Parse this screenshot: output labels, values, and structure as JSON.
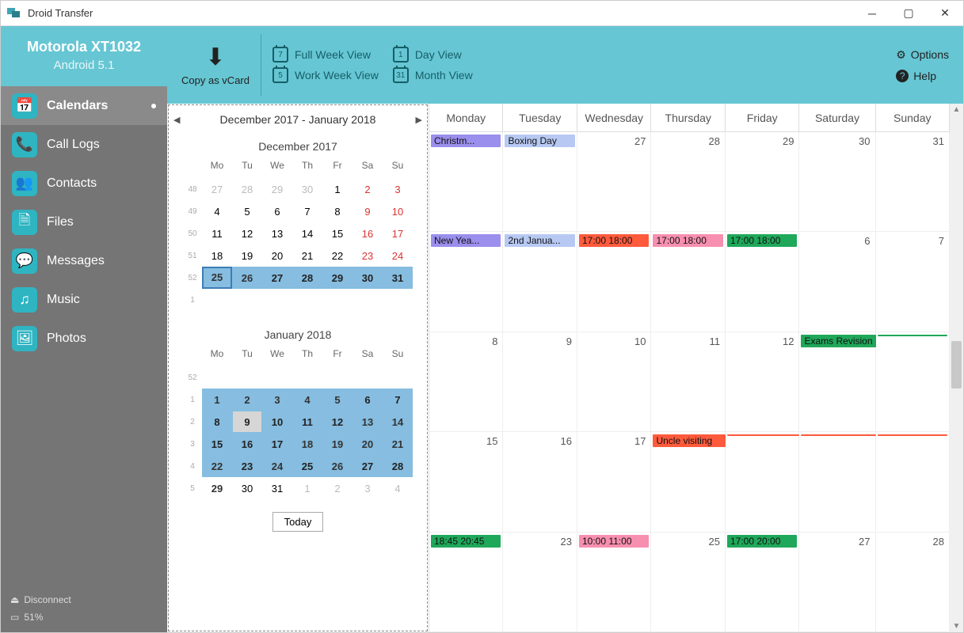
{
  "window": {
    "title": "Droid Transfer"
  },
  "device": {
    "name": "Motorola XT1032",
    "os": "Android 5.1"
  },
  "sidebar": {
    "items": [
      {
        "label": "Calendars",
        "icon": "calendar"
      },
      {
        "label": "Call Logs",
        "icon": "phone"
      },
      {
        "label": "Contacts",
        "icon": "contacts"
      },
      {
        "label": "Files",
        "icon": "files"
      },
      {
        "label": "Messages",
        "icon": "messages"
      },
      {
        "label": "Music",
        "icon": "music"
      },
      {
        "label": "Photos",
        "icon": "photos"
      }
    ],
    "active_index": 0,
    "disconnect": "Disconnect",
    "battery_pct": "51%"
  },
  "toolbar": {
    "copy_label": "Copy as vCard",
    "view_full": "Full Week View",
    "view_day": "Day View",
    "view_work": "Work Week View",
    "view_month": "Month View",
    "options": "Options",
    "help": "Help",
    "view_icon_full": "7",
    "view_icon_day": "1",
    "view_icon_work": "5",
    "view_icon_month": "31"
  },
  "mini_calendar": {
    "range_label": "December 2017 - January 2018",
    "today_label": "Today",
    "day_headers": [
      "Mo",
      "Tu",
      "We",
      "Th",
      "Fr",
      "Sa",
      "Su"
    ],
    "months": [
      {
        "title": "December 2017",
        "weeks": [
          {
            "wn": "48",
            "days": [
              {
                "n": "27",
                "dim": true
              },
              {
                "n": "28",
                "dim": true
              },
              {
                "n": "29",
                "dim": true
              },
              {
                "n": "30",
                "dim": true
              },
              {
                "n": "1"
              },
              {
                "n": "2",
                "wk": true
              },
              {
                "n": "3",
                "wk": true
              }
            ]
          },
          {
            "wn": "49",
            "days": [
              {
                "n": "4"
              },
              {
                "n": "5"
              },
              {
                "n": "6"
              },
              {
                "n": "7"
              },
              {
                "n": "8"
              },
              {
                "n": "9",
                "wk": true
              },
              {
                "n": "10",
                "wk": true
              }
            ]
          },
          {
            "wn": "50",
            "days": [
              {
                "n": "11"
              },
              {
                "n": "12"
              },
              {
                "n": "13"
              },
              {
                "n": "14"
              },
              {
                "n": "15"
              },
              {
                "n": "16",
                "wk": true
              },
              {
                "n": "17",
                "wk": true
              }
            ]
          },
          {
            "wn": "51",
            "days": [
              {
                "n": "18"
              },
              {
                "n": "19"
              },
              {
                "n": "20"
              },
              {
                "n": "21"
              },
              {
                "n": "22"
              },
              {
                "n": "23",
                "wk": true
              },
              {
                "n": "24",
                "wk": true
              }
            ]
          },
          {
            "wn": "52",
            "days": [
              {
                "n": "25",
                "sel": true,
                "ss": true,
                "bold": true
              },
              {
                "n": "26",
                "sel": true,
                "bold": true
              },
              {
                "n": "27",
                "sel": true
              },
              {
                "n": "28",
                "sel": true
              },
              {
                "n": "29",
                "sel": true
              },
              {
                "n": "30",
                "sel": true
              },
              {
                "n": "31",
                "sel": true
              }
            ]
          },
          {
            "wn": "1",
            "days": [
              {
                "n": ""
              },
              {
                "n": ""
              },
              {
                "n": ""
              },
              {
                "n": ""
              },
              {
                "n": ""
              },
              {
                "n": ""
              },
              {
                "n": ""
              }
            ]
          }
        ]
      },
      {
        "title": "January 2018",
        "weeks": [
          {
            "wn": "52",
            "days": [
              {
                "n": ""
              },
              {
                "n": ""
              },
              {
                "n": ""
              },
              {
                "n": ""
              },
              {
                "n": ""
              },
              {
                "n": ""
              },
              {
                "n": ""
              }
            ]
          },
          {
            "wn": "1",
            "days": [
              {
                "n": "1",
                "sel": true,
                "bold": true
              },
              {
                "n": "2",
                "sel": true,
                "bold": true
              },
              {
                "n": "3",
                "sel": true,
                "bold": true
              },
              {
                "n": "4",
                "sel": true,
                "bold": true
              },
              {
                "n": "5",
                "sel": true,
                "bold": true
              },
              {
                "n": "6",
                "sel": true
              },
              {
                "n": "7",
                "sel": true
              }
            ]
          },
          {
            "wn": "2",
            "days": [
              {
                "n": "8",
                "sel": true
              },
              {
                "n": "9",
                "sel": true,
                "today": true
              },
              {
                "n": "10",
                "sel": true
              },
              {
                "n": "11",
                "sel": true
              },
              {
                "n": "12",
                "sel": true
              },
              {
                "n": "13",
                "sel": true,
                "bold": true
              },
              {
                "n": "14",
                "sel": true,
                "bold": true
              }
            ]
          },
          {
            "wn": "3",
            "days": [
              {
                "n": "15",
                "sel": true
              },
              {
                "n": "16",
                "sel": true
              },
              {
                "n": "17",
                "sel": true
              },
              {
                "n": "18",
                "sel": true,
                "bold": true
              },
              {
                "n": "19",
                "sel": true,
                "bold": true
              },
              {
                "n": "20",
                "sel": true,
                "bold": true
              },
              {
                "n": "21",
                "sel": true,
                "bold": true
              }
            ]
          },
          {
            "wn": "4",
            "days": [
              {
                "n": "22",
                "sel": true,
                "bold": true
              },
              {
                "n": "23",
                "sel": true
              },
              {
                "n": "24",
                "sel": true,
                "bold": true
              },
              {
                "n": "25",
                "sel": true
              },
              {
                "n": "26",
                "sel": true,
                "bold": true
              },
              {
                "n": "27",
                "sel": true
              },
              {
                "n": "28",
                "sel": true
              }
            ]
          },
          {
            "wn": "5",
            "days": [
              {
                "n": "29",
                "bold": true
              },
              {
                "n": "30"
              },
              {
                "n": "31"
              },
              {
                "n": "1",
                "dim": true
              },
              {
                "n": "2",
                "dim": true
              },
              {
                "n": "3",
                "dim": true
              },
              {
                "n": "4",
                "dim": true
              }
            ]
          }
        ]
      }
    ]
  },
  "month_view": {
    "headers": [
      "Monday",
      "Tuesday",
      "Wednesday",
      "Thursday",
      "Friday",
      "Saturday",
      "Sunday"
    ],
    "weeks": [
      [
        {
          "n": "",
          "events": [
            {
              "t": "Christm...",
              "bg": "#9a8fec",
              "fg": "#111"
            }
          ]
        },
        {
          "n": "",
          "events": [
            {
              "t": "Boxing Day",
              "bg": "#b7c9f3",
              "fg": "#111"
            }
          ]
        },
        {
          "n": "27",
          "events": []
        },
        {
          "n": "28",
          "events": []
        },
        {
          "n": "29",
          "events": []
        },
        {
          "n": "30",
          "events": []
        },
        {
          "n": "31",
          "events": []
        }
      ],
      [
        {
          "n": "",
          "events": [
            {
              "t": "New Yea...",
              "bg": "#9a8fec",
              "fg": "#111"
            }
          ]
        },
        {
          "n": "",
          "events": [
            {
              "t": "2nd Janua...",
              "bg": "#b7c9f3",
              "fg": "#111"
            }
          ]
        },
        {
          "n": "",
          "events": [
            {
              "t": "17:00  18:00",
              "bg": "#ff5a3c",
              "fg": "#111"
            }
          ]
        },
        {
          "n": "",
          "events": [
            {
              "t": "17:00  18:00",
              "bg": "#f78fb0",
              "fg": "#111"
            }
          ]
        },
        {
          "n": "",
          "events": [
            {
              "t": "17:00  18:00",
              "bg": "#1fa85a",
              "fg": "#111"
            }
          ]
        },
        {
          "n": "6",
          "events": []
        },
        {
          "n": "7",
          "events": []
        }
      ],
      [
        {
          "n": "8",
          "events": []
        },
        {
          "n": "9",
          "events": []
        },
        {
          "n": "10",
          "events": []
        },
        {
          "n": "11",
          "events": []
        },
        {
          "n": "12",
          "events": []
        },
        {
          "n": "",
          "events": [
            {
              "t": "Exams Revision",
              "bg": "#1fa85a",
              "fg": "#111",
              "span": true
            }
          ]
        },
        {
          "n": "",
          "events": [
            {
              "t": "",
              "bg": "#1fa85a",
              "fg": "#111"
            }
          ]
        }
      ],
      [
        {
          "n": "15",
          "events": []
        },
        {
          "n": "16",
          "events": []
        },
        {
          "n": "17",
          "events": []
        },
        {
          "n": "",
          "events": [
            {
              "t": "Uncle visiting",
              "bg": "#ff5a3c",
              "fg": "#111",
              "span": true
            }
          ]
        },
        {
          "n": "",
          "events": [
            {
              "t": "",
              "bg": "#ff5a3c",
              "fg": "#111",
              "span": true
            }
          ]
        },
        {
          "n": "",
          "events": [
            {
              "t": "",
              "bg": "#ff5a3c",
              "fg": "#111",
              "span": true
            }
          ]
        },
        {
          "n": "",
          "events": [
            {
              "t": "",
              "bg": "#ff5a3c",
              "fg": "#111"
            }
          ]
        }
      ],
      [
        {
          "n": "",
          "events": [
            {
              "t": "18:45  20:45",
              "bg": "#1fa85a",
              "fg": "#111"
            }
          ]
        },
        {
          "n": "23",
          "events": []
        },
        {
          "n": "",
          "events": [
            {
              "t": "10:00  11:00",
              "bg": "#f78fb0",
              "fg": "#111"
            }
          ]
        },
        {
          "n": "25",
          "events": []
        },
        {
          "n": "",
          "events": [
            {
              "t": "17:00  20:00",
              "bg": "#1fa85a",
              "fg": "#111"
            }
          ]
        },
        {
          "n": "27",
          "events": []
        },
        {
          "n": "28",
          "events": []
        }
      ]
    ]
  }
}
